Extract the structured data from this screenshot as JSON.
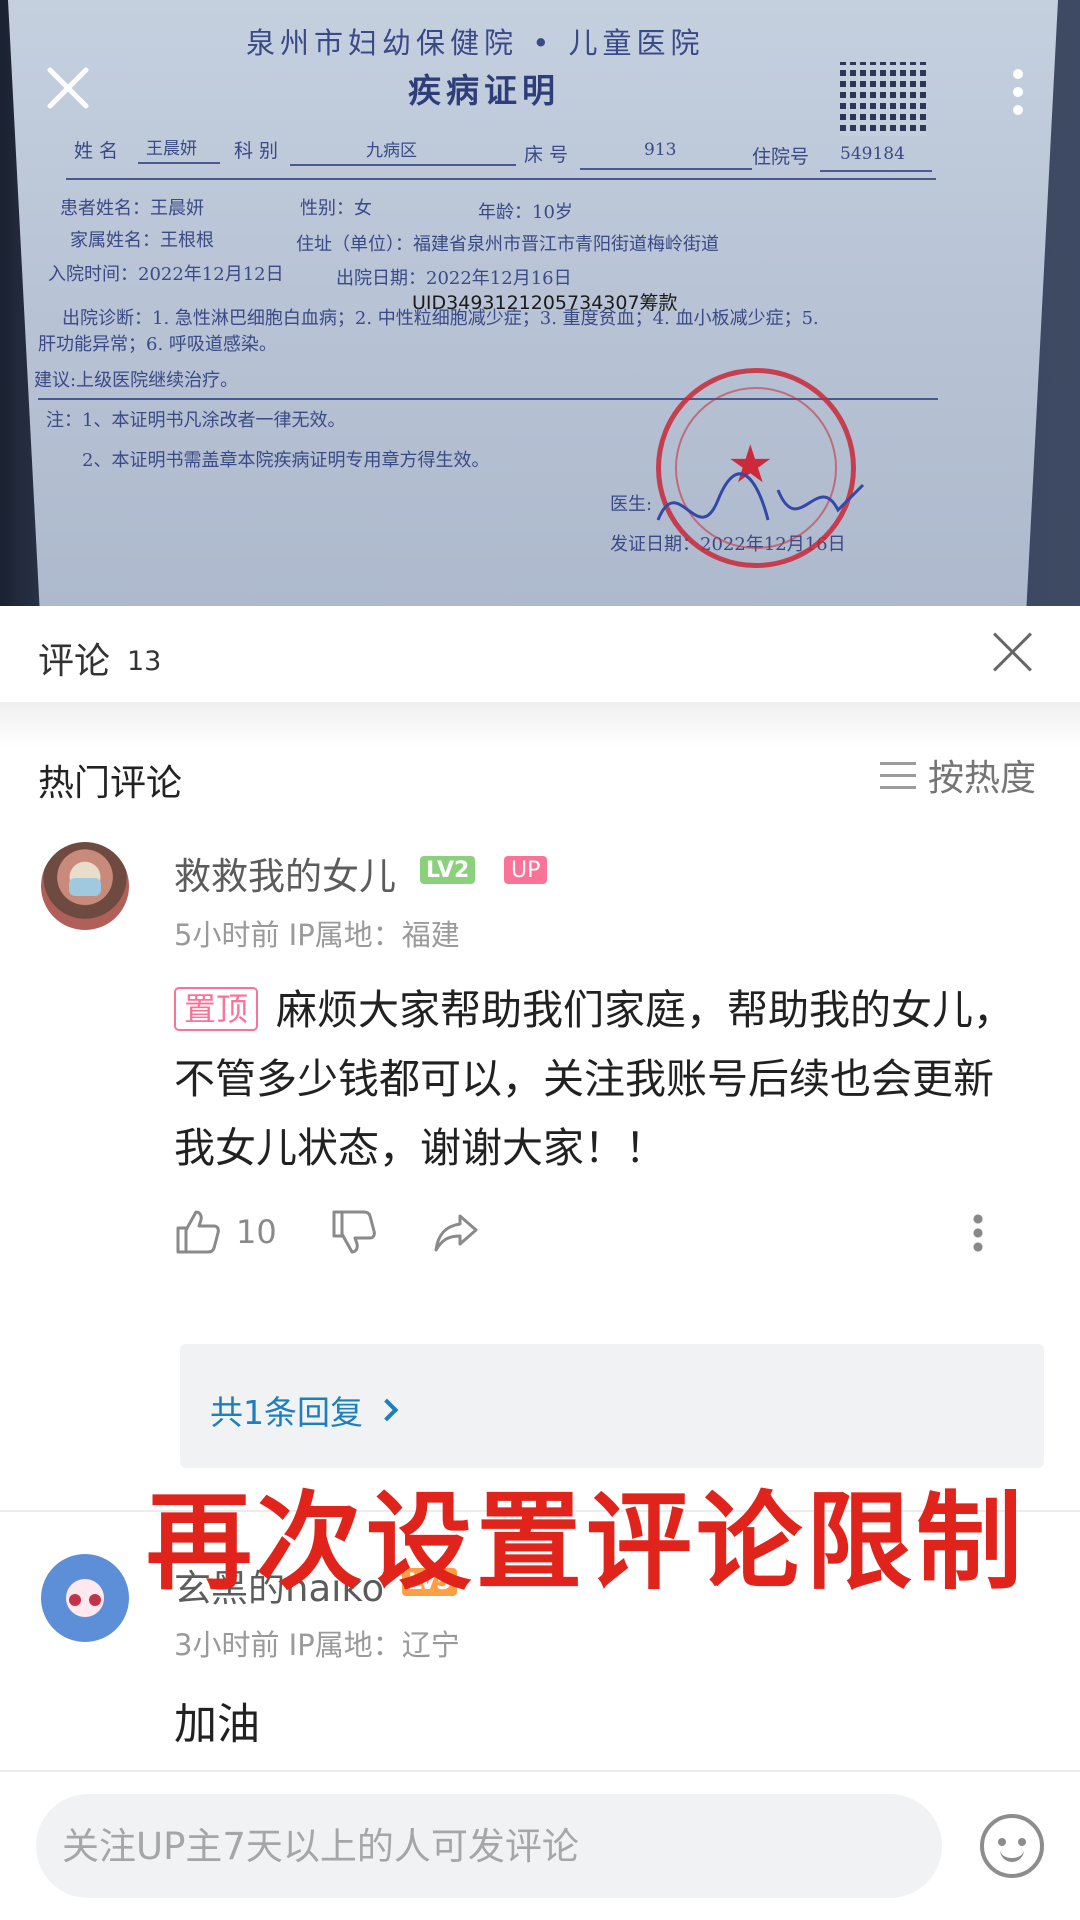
{
  "document": {
    "hospital_name": "泉州市妇幼保健院 • 儿童医院",
    "doc_title": "疾病证明",
    "fields_row": {
      "name_label": "姓 名",
      "name_value": "王晨妍",
      "dept_label": "科 别",
      "dept_value": "九病区",
      "bed_label": "床 号",
      "bed_value": "913",
      "admit_no_label": "住院号",
      "admit_no_value": "549184"
    },
    "line_patient": "患者姓名：王晨妍",
    "line_gender": "性别：女",
    "line_age": "年龄：10岁",
    "line_family": "家属姓名：王根根",
    "line_address": "住址（单位）：福建省泉州市晋江市青阳街道梅岭街道",
    "line_admit_date": "入院时间：2022年12月12日",
    "line_discharge_date": "出院日期：2022年12月16日",
    "uid_overlay": "UID3493121205734307筹款",
    "line_diagnosis_1": "出院诊断：1. 急性淋巴细胞白血病；2. 中性粒细胞减少症；3. 重度贫血；4. 血小板减少症；5.",
    "line_diagnosis_2": "肝功能异常；6. 呼吸道感染。",
    "line_advice": "建议:上级医院继续治疗。",
    "line_note_1": "注：1、本证明书凡涂改者一律无效。",
    "line_note_2": "2、本证明书需盖章本院疾病证明专用章方得生效。",
    "doctor_label": "医生:",
    "issue_date": "发证日期：2022年12月16日",
    "stamp_text": "疾病证明专用章"
  },
  "panel": {
    "title": "评论",
    "count": "13",
    "hot_title": "热门评论",
    "sort_label": "按热度"
  },
  "comments": [
    {
      "user": "救救我的女儿",
      "level": "LV2",
      "up_badge": "UP",
      "meta": "5小时前  IP属地：福建",
      "pin_label": "置顶",
      "text": "麻烦大家帮助我们家庭，帮助我的女儿，不管多少钱都可以，关注我账号后续也会更新我女儿状态，谢谢大家！！",
      "likes": "10",
      "reply_link": "共1条回复"
    },
    {
      "user": "玄黑的naiko",
      "level": "LV5",
      "meta": "3小时前  IP属地：辽宁",
      "text": "加油"
    }
  ],
  "overlay_caption": "再次设置评论限制",
  "input": {
    "placeholder": "关注UP主7天以上的人可发评论"
  },
  "colors": {
    "accent_pink": "#fb7299",
    "link_blue": "#1e7fbf",
    "caption_red": "#e0241c",
    "lv2_green": "#8bd07c",
    "lv5_orange": "#ff9f43"
  },
  "icons": [
    "close-icon",
    "more-vertical-icon",
    "sort-lines-icon",
    "like-icon",
    "dislike-icon",
    "share-icon",
    "chevron-right-icon",
    "emoji-icon"
  ]
}
